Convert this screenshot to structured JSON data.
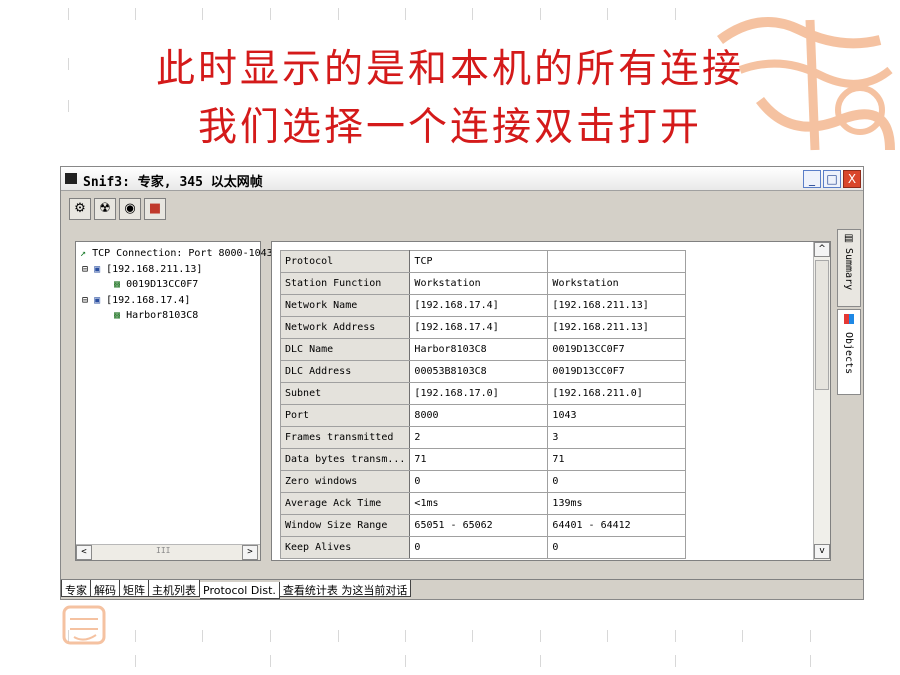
{
  "slide": {
    "title_line1": "此时显示的是和本机的所有连接",
    "title_line2": "我们选择一个连接双击打开",
    "title_color": "#d41a1a"
  },
  "window": {
    "title": "Snif3: 专家, 345 以太网帧",
    "controls": {
      "minimize": "_",
      "maximize": "□",
      "close": "X"
    },
    "toolbar_icons": [
      "expert-icon",
      "filter-icon",
      "capture-icon",
      "export-icon"
    ]
  },
  "tree": {
    "root": "TCP Connection: Port 8000-1043",
    "nodes": [
      {
        "ip": "[192.168.211.13]",
        "child": "0019D13CC0F7"
      },
      {
        "ip": "[192.168.17.4]",
        "child": "Harbor8103C8"
      }
    ],
    "scroll_left": "<",
    "scroll_mid": "III",
    "scroll_right": ">"
  },
  "details": {
    "rows": [
      [
        "Protocol",
        "TCP",
        ""
      ],
      [
        "Station Function",
        "Workstation",
        "Workstation"
      ],
      [
        "Network Name",
        "[192.168.17.4]",
        "[192.168.211.13]"
      ],
      [
        "Network Address",
        "[192.168.17.4]",
        "[192.168.211.13]"
      ],
      [
        "DLC Name",
        "Harbor8103C8",
        "0019D13CC0F7"
      ],
      [
        "DLC Address",
        "00053B8103C8",
        "0019D13CC0F7"
      ],
      [
        "Subnet",
        "[192.168.17.0]",
        "[192.168.211.0]"
      ],
      [
        "Port",
        "8000",
        "1043"
      ],
      [
        "Frames transmitted",
        "2",
        "3"
      ],
      [
        "Data bytes transm...",
        "71",
        "71"
      ],
      [
        "Zero windows",
        "0",
        "0"
      ],
      [
        "Average Ack Time",
        "<1ms",
        "139ms"
      ],
      [
        "Window Size Range",
        "65051 - 65062",
        "64401 - 64412"
      ],
      [
        "Keep Alives",
        "0",
        "0"
      ]
    ],
    "scroll_up": "^",
    "scroll_down": "v"
  },
  "side_tabs": [
    "Summary",
    "Objects"
  ],
  "bottom_tabs": [
    "专家",
    "解码",
    "矩阵",
    "主机列表",
    "Protocol Dist.",
    "查看统计表 为这当前对话"
  ]
}
